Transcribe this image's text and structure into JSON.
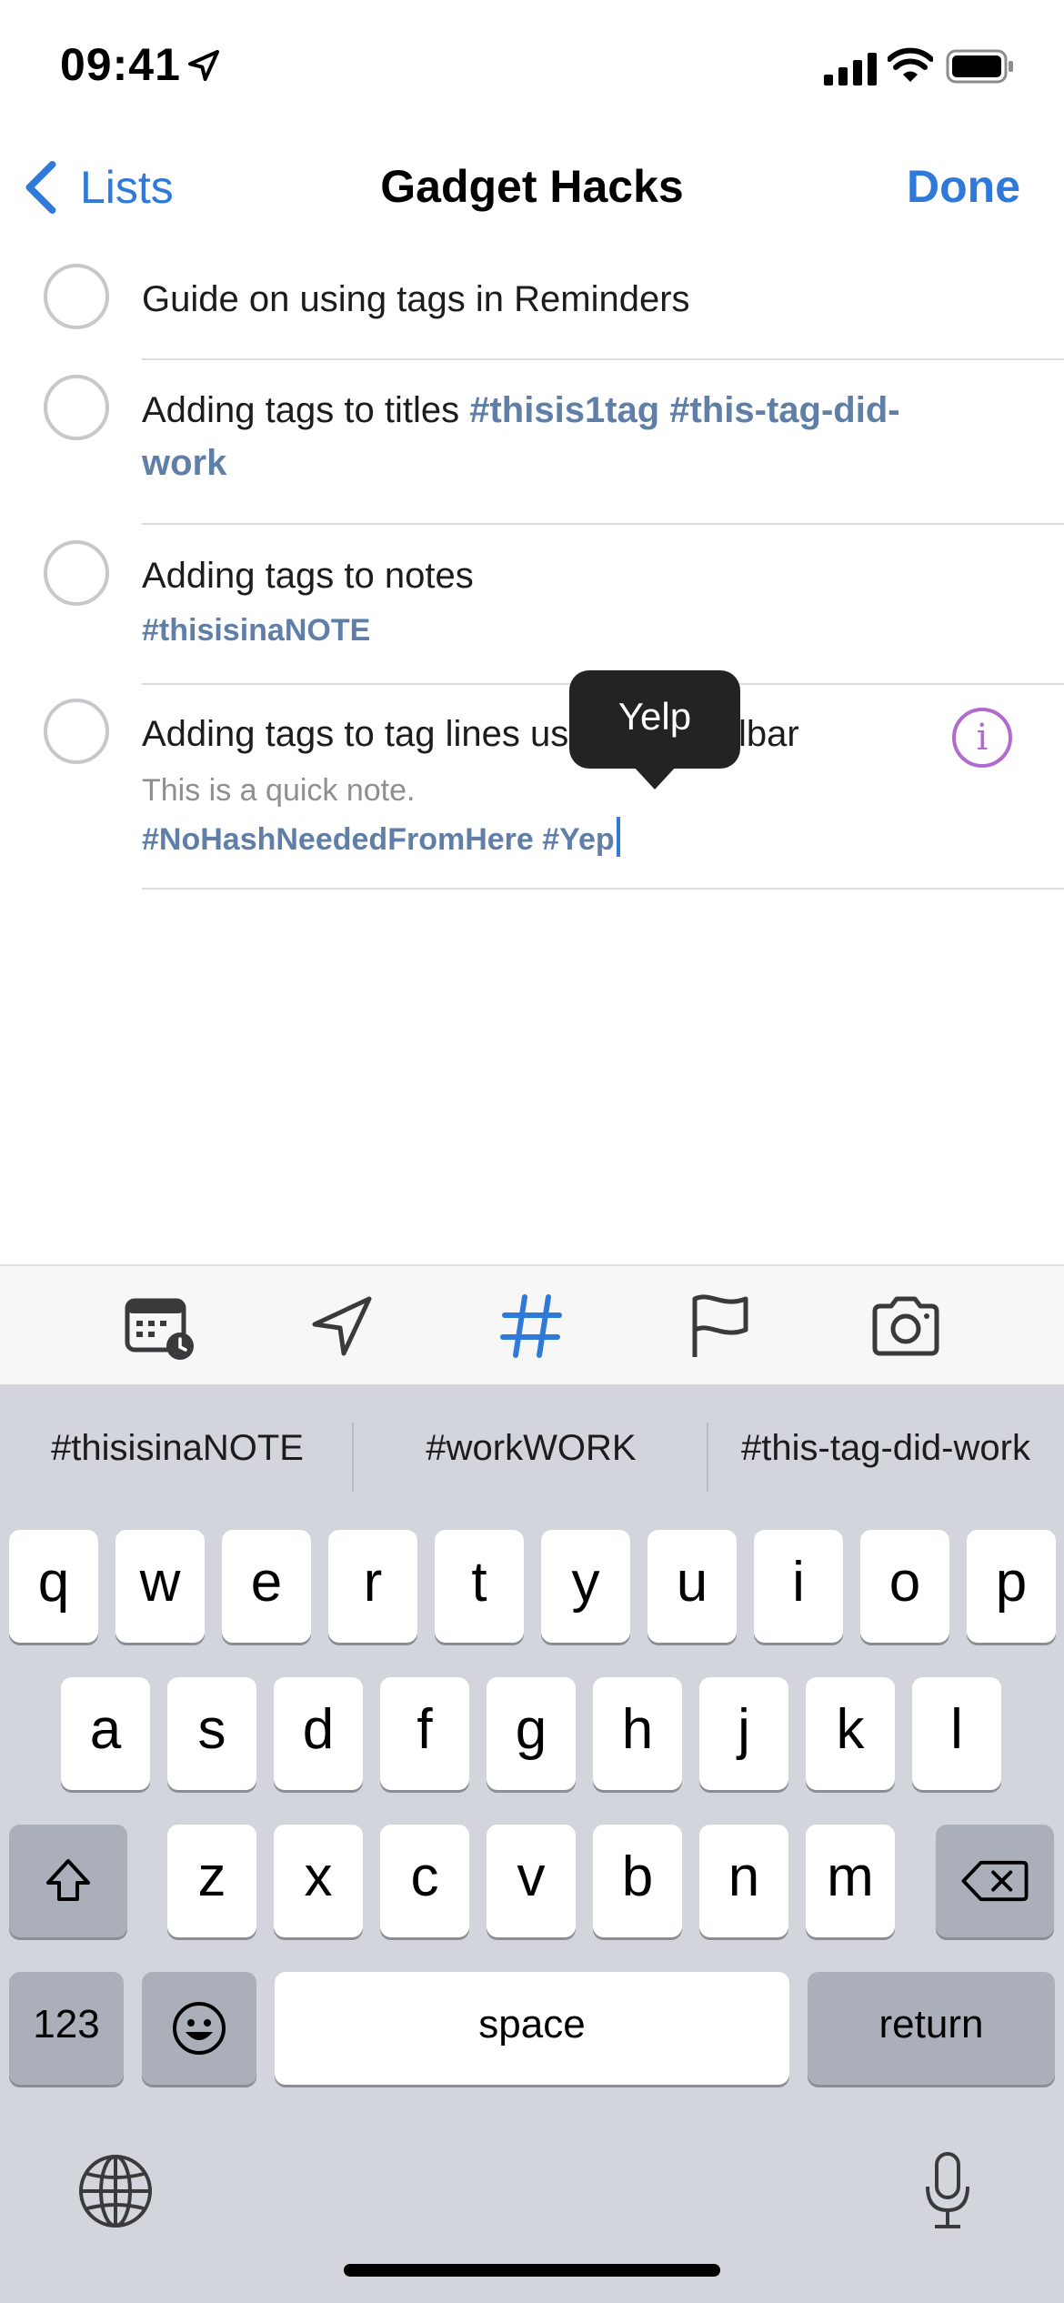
{
  "status_bar": {
    "time": "09:41",
    "icons": [
      "location-arrow-icon",
      "cellular-signal-icon",
      "wifi-icon",
      "battery-icon"
    ]
  },
  "nav": {
    "back_label": "Lists",
    "title": "Gadget Hacks",
    "done_label": "Done"
  },
  "reminders": [
    {
      "title": "Guide on using tags in Reminders"
    },
    {
      "title_plain": "Adding tags to titles ",
      "title_tags_1": "#thisis1tag #this-tag-did-",
      "title_tags_2": "work"
    },
    {
      "title": "Adding tags to notes",
      "tags": "#thisisinaNOTE"
    },
    {
      "title": "Adding tags to tag lines using the toolbar",
      "note": "This is a quick note.",
      "tags": "#NoHashNeededFromHere #Yep"
    }
  ],
  "tooltip": {
    "text": "Yelp"
  },
  "toolbar": {
    "icons": [
      "calendar-clock-icon",
      "location-icon",
      "hashtag-icon",
      "flag-icon",
      "camera-icon"
    ]
  },
  "keyboard": {
    "suggestions": [
      "#thisisinaNOTE",
      "#workWORK",
      "#this-tag-did-work"
    ],
    "row1": [
      "q",
      "w",
      "e",
      "r",
      "t",
      "y",
      "u",
      "i",
      "o",
      "p"
    ],
    "row2": [
      "a",
      "s",
      "d",
      "f",
      "g",
      "h",
      "j",
      "k",
      "l"
    ],
    "row3": [
      "z",
      "x",
      "c",
      "v",
      "b",
      "n",
      "m"
    ],
    "numbers_label": "123",
    "space_label": "space",
    "return_label": "return"
  },
  "colors": {
    "accent": "#2f7ad9",
    "tag": "#5f7fa8",
    "info": "#b06ad0",
    "keyboard_bg": "#d2d5db"
  }
}
